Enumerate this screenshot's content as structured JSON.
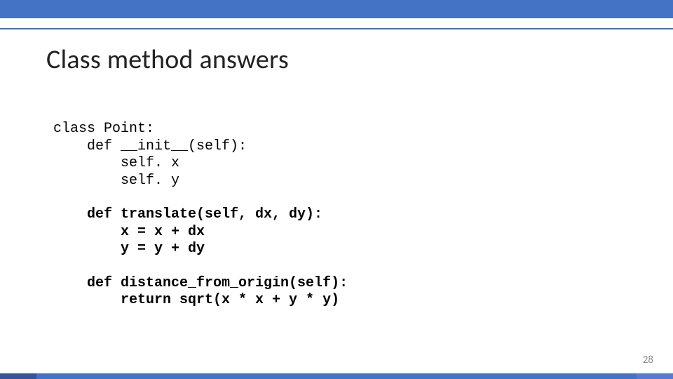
{
  "title": "Class method answers",
  "code": {
    "line1": "class Point:",
    "line2": "    def __init__(self):",
    "line3": "        self. x",
    "line4": "        self. y",
    "line5_b": "    def translate(self, dx, dy):",
    "line6_b": "        x = x + dx",
    "line7_b": "        y = y + dy",
    "line8_b": "    def distance_from_origin(self):",
    "line9_b": "        return sqrt(x * x + y * y)"
  },
  "page_number": "28",
  "colors": {
    "accent": "#4472c4"
  }
}
